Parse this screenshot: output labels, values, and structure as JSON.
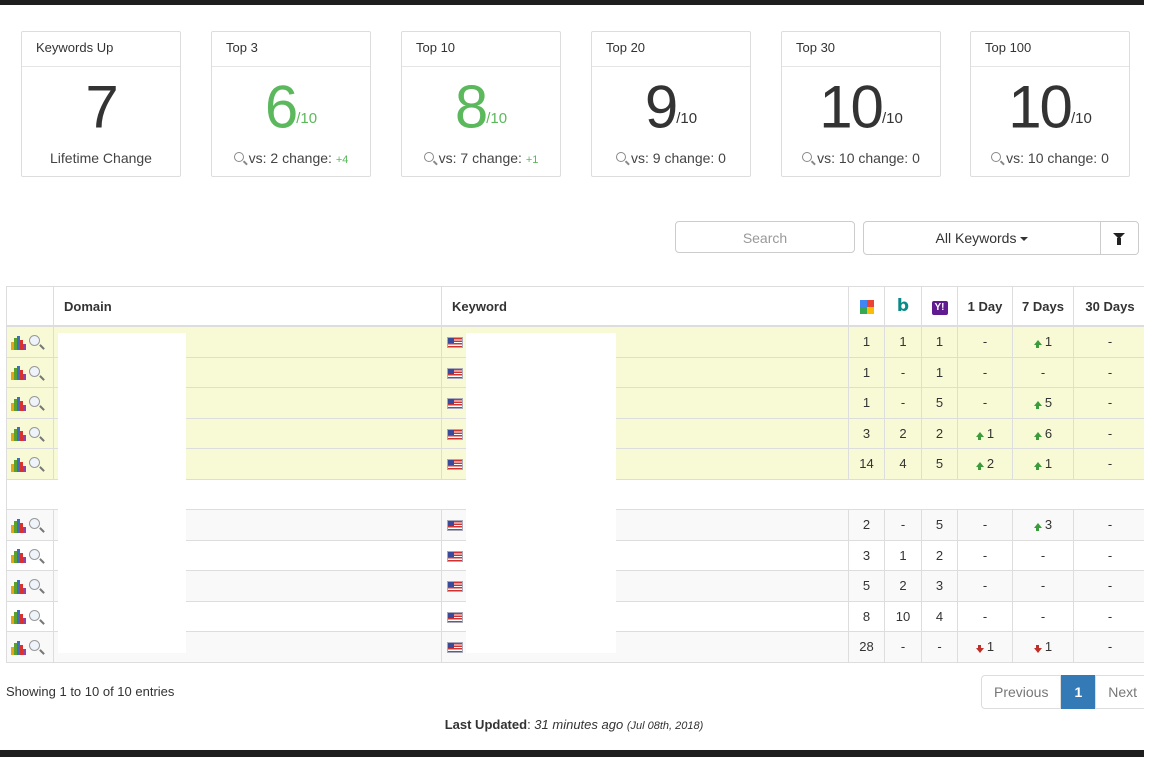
{
  "cards": [
    {
      "title": "Keywords Up",
      "value": "7",
      "denom": "",
      "foot": "Lifetime Change",
      "change": "",
      "color": "dark"
    },
    {
      "title": "Top 3",
      "value": "6",
      "denom": "/10",
      "foot": "vs: 2 change: ",
      "change": "+4",
      "color": "green"
    },
    {
      "title": "Top 10",
      "value": "8",
      "denom": "/10",
      "foot": "vs: 7 change: ",
      "change": "+1",
      "color": "green"
    },
    {
      "title": "Top 20",
      "value": "9",
      "denom": "/10",
      "foot": "vs: 9 change: 0",
      "change": "",
      "color": "dark"
    },
    {
      "title": "Top 30",
      "value": "10",
      "denom": "/10",
      "foot": "vs: 10 change: 0",
      "change": "",
      "color": "dark"
    },
    {
      "title": "Top 100",
      "value": "10",
      "denom": "/10",
      "foot": "vs: 10 change: 0",
      "change": "",
      "color": "dark"
    }
  ],
  "controls": {
    "search_placeholder": "Search",
    "filter_label": "All Keywords"
  },
  "table": {
    "headers": {
      "domain": "Domain",
      "keyword": "Keyword",
      "day1": "1 Day",
      "day7": "7 Days",
      "day30": "30 Days",
      "yahoo": "Y!"
    },
    "rows": [
      {
        "google": "1",
        "bing": "1",
        "yahoo": "1",
        "d1": "-",
        "d1dir": "",
        "d7": "1",
        "d7dir": "up",
        "d30": "-",
        "style": "hl"
      },
      {
        "google": "1",
        "bing": "-",
        "yahoo": "1",
        "d1": "-",
        "d1dir": "",
        "d7": "-",
        "d7dir": "",
        "d30": "-",
        "style": "hl"
      },
      {
        "google": "1",
        "bing": "-",
        "yahoo": "5",
        "d1": "-",
        "d1dir": "",
        "d7": "5",
        "d7dir": "up",
        "d30": "-",
        "style": "hl"
      },
      {
        "google": "3",
        "bing": "2",
        "yahoo": "2",
        "d1": "1",
        "d1dir": "up",
        "d7": "6",
        "d7dir": "up",
        "d30": "-",
        "style": "hl"
      },
      {
        "google": "14",
        "bing": "4",
        "yahoo": "5",
        "d1": "2",
        "d1dir": "up",
        "d7": "1",
        "d7dir": "up",
        "d30": "-",
        "style": "hl"
      },
      {
        "google": "2",
        "bing": "-",
        "yahoo": "5",
        "d1": "-",
        "d1dir": "",
        "d7": "3",
        "d7dir": "up",
        "d30": "-",
        "style": "even"
      },
      {
        "google": "3",
        "bing": "1",
        "yahoo": "2",
        "d1": "-",
        "d1dir": "",
        "d7": "-",
        "d7dir": "",
        "d30": "-",
        "style": "odd"
      },
      {
        "google": "5",
        "bing": "2",
        "yahoo": "3",
        "d1": "-",
        "d1dir": "",
        "d7": "-",
        "d7dir": "",
        "d30": "-",
        "style": "even"
      },
      {
        "google": "8",
        "bing": "10",
        "yahoo": "4",
        "d1": "-",
        "d1dir": "",
        "d7": "-",
        "d7dir": "",
        "d30": "-",
        "style": "odd"
      },
      {
        "google": "28",
        "bing": "-",
        "yahoo": "-",
        "d1": "1",
        "d1dir": "down",
        "d7": "1",
        "d7dir": "down",
        "d30": "-",
        "style": "even"
      }
    ]
  },
  "footer": {
    "info": "Showing 1 to 10 of 10 entries",
    "prev": "Previous",
    "page": "1",
    "next": "Next",
    "updated_label": "Last Updated",
    "updated_ago": "31 minutes ago",
    "updated_date": "(Jul 08th, 2018)"
  },
  "colors": {
    "green": "#5cb85c",
    "up_arrow": "#3c9c3c",
    "down_arrow": "#c0302b",
    "highlight_row": "#f8fad6",
    "pager_active": "#337ab7"
  }
}
